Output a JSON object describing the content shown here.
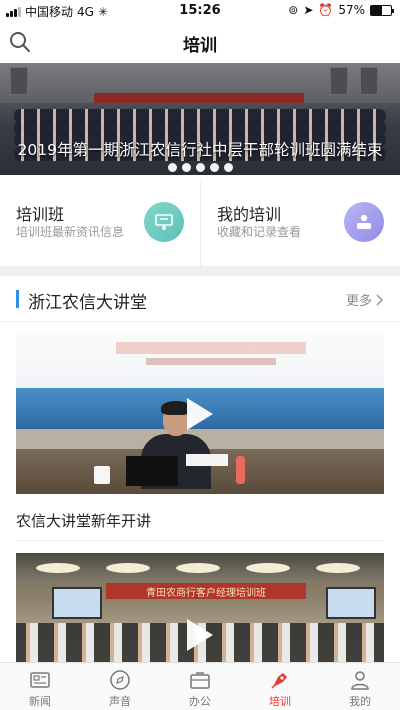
{
  "status_bar": {
    "carrier": "中国移动",
    "network": "4G",
    "time": "15:26",
    "battery": "57%",
    "battery_level": 0.57
  },
  "header": {
    "title": "培训",
    "search_icon": "search-icon"
  },
  "banner": {
    "caption": "2019年第一期浙江农信行社中层干部轮训班圆满结束",
    "dot_count": 5
  },
  "features": [
    {
      "title": "培训班",
      "subtitle": "培训班最新资讯信息",
      "icon": "presentation-icon",
      "color": "#6fcdbf"
    },
    {
      "title": "我的培训",
      "subtitle": "收藏和记录查看",
      "icon": "trainee-icon",
      "color": "#a3a0ee"
    }
  ],
  "section": {
    "title": "浙江农信大讲堂",
    "more": "更多"
  },
  "videos": [
    {
      "title": "农信大讲堂新年开讲"
    },
    {
      "banner_text": "青田农商行客户经理培训班"
    }
  ],
  "tabbar": {
    "items": [
      {
        "label": "新闻",
        "icon": "newspaper-icon"
      },
      {
        "label": "声音",
        "icon": "compass-icon"
      },
      {
        "label": "办公",
        "icon": "briefcase-icon"
      },
      {
        "label": "培训",
        "icon": "pen-nib-icon"
      },
      {
        "label": "我的",
        "icon": "user-icon"
      }
    ],
    "active": "培训",
    "active_color": "#e53b33"
  },
  "colors": {
    "accent_blue": "#2f8fe8",
    "tab_active": "#e53b33"
  }
}
